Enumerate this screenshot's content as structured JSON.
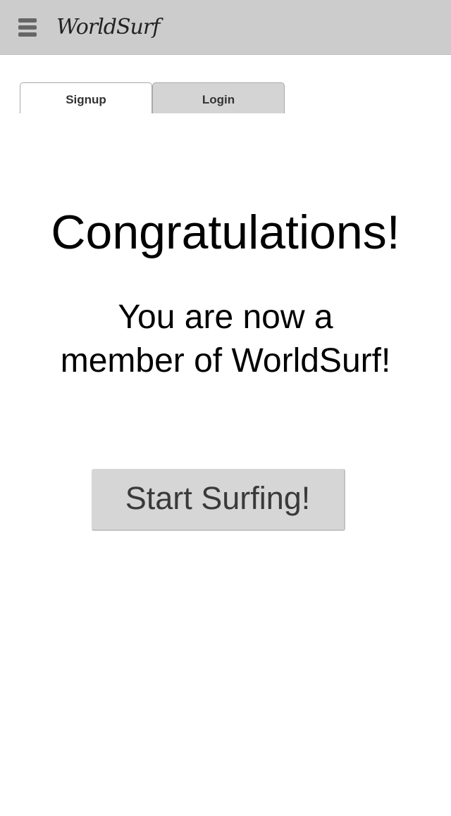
{
  "header": {
    "brand": "WorldSurf",
    "menu_icon": "hamburger-menu-icon"
  },
  "tabs": [
    {
      "label": "Signup",
      "active": true
    },
    {
      "label": "Login",
      "active": false
    }
  ],
  "main": {
    "headline": "Congratulations!",
    "message_line1": "You are now a",
    "message_line2": "member of WorldSurf!",
    "cta_label": "Start Surfing!"
  },
  "colors": {
    "header_bg": "#cccccc",
    "tab_inactive_bg": "#d4d4d4",
    "button_bg": "#d6d6d6"
  }
}
